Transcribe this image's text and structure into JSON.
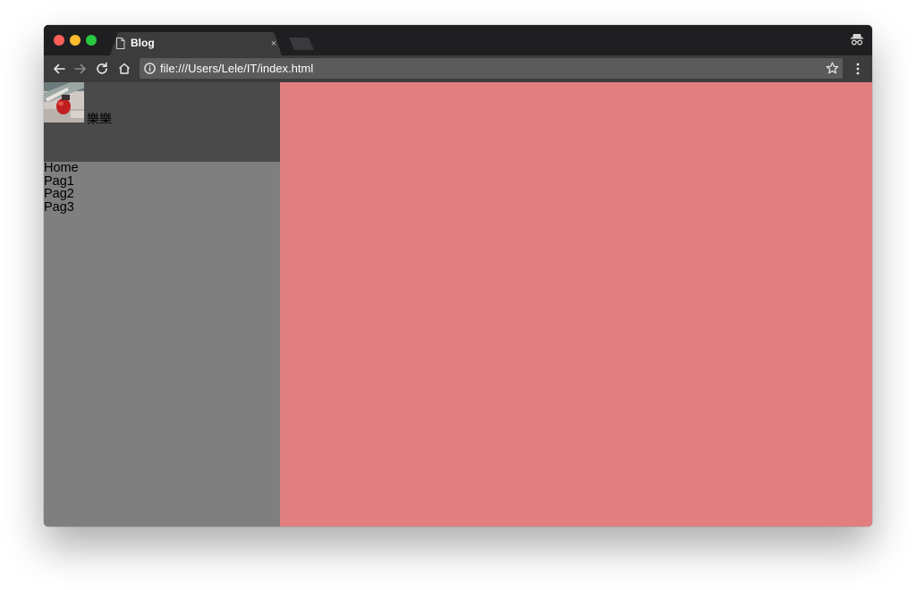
{
  "browser": {
    "tab": {
      "title": "Blog",
      "close_glyph": "×",
      "icon": "page-icon"
    },
    "address_bar": {
      "url": "file:///Users/Lele/IT/index.html",
      "info_icon": "info-icon",
      "bookmark_icon": "star-icon"
    },
    "toolbar_icons": [
      "back-icon",
      "forward-icon",
      "reload-icon",
      "home-icon",
      "menu-icon"
    ],
    "incognito_icon": "incognito-icon"
  },
  "page": {
    "profile": {
      "name": "樂樂"
    },
    "nav": {
      "items": [
        {
          "label": "Home"
        },
        {
          "label": "Pag1"
        },
        {
          "label": "Pag2"
        },
        {
          "label": "Pag3"
        }
      ]
    }
  },
  "colors": {
    "sidebar": "#7f7f7f",
    "profile_header": "#4a4a4a",
    "content": "#e17f80",
    "toolbar": "#3c3c3c",
    "titlebar": "#1f1f21"
  }
}
